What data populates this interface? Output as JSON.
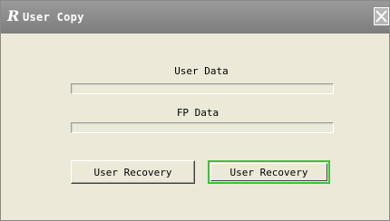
{
  "window": {
    "title": "User Copy",
    "title_icon": "R",
    "close_icon": "close-icon"
  },
  "sections": {
    "user_data_label": "User Data",
    "fp_data_label": "FP Data"
  },
  "progress": {
    "user_data": 0,
    "fp_data": 0
  },
  "buttons": {
    "left_label": "User Recovery",
    "right_label": "User Recovery"
  },
  "colors": {
    "highlight": "#36c537",
    "titlebar": "#8c8c8c",
    "background": "#ece9d8"
  }
}
